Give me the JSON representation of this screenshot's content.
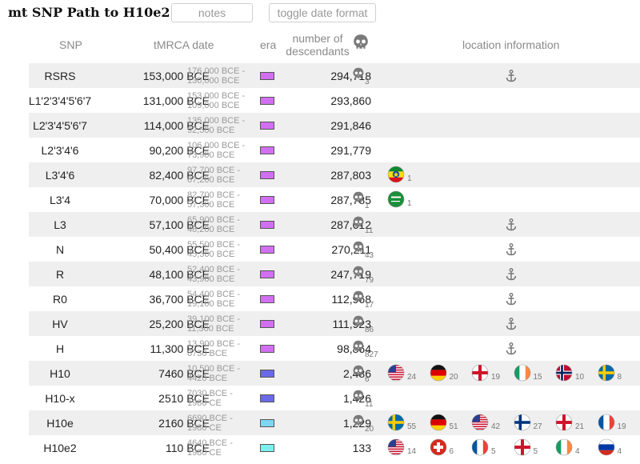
{
  "app": {
    "title": "mt SNP Path to H10e2",
    "notes_button": "notes",
    "date_button": "toggle date format"
  },
  "columns": {
    "snp": "SNP",
    "tmrca": "tMRCA date",
    "era": "era",
    "descendants_1": "number of",
    "descendants_2": "descendants",
    "location": "location information"
  },
  "colors": {
    "era_purple": "#d070f0",
    "era_blue": "#6a6ae8",
    "era_sky": "#7fd6f2",
    "era_aqua": "#7ef0f0",
    "stripe": "#efefef"
  },
  "rows": [
    {
      "snp": "RSRS",
      "date": "153,000 BCE",
      "range1": "176,000 BCE -",
      "range2": "130,000 BCE",
      "era": "era_purple",
      "descendants": "294,718",
      "skull": "3",
      "anchor": true,
      "flags": []
    },
    {
      "snp": "L1'2'3'4'5'6'7",
      "date": "131,000 BCE",
      "range1": "153,000 BCE -",
      "range2": "109,000 BCE",
      "era": "era_purple",
      "descendants": "293,860",
      "skull": null,
      "anchor": false,
      "flags": []
    },
    {
      "snp": "L2'3'4'5'6'7",
      "date": "114,000 BCE",
      "range1": "135,000 BCE -",
      "range2": "92,500 BCE",
      "era": "era_purple",
      "descendants": "291,846",
      "skull": null,
      "anchor": false,
      "flags": []
    },
    {
      "snp": "L2'3'4'6",
      "date": "90,200 BCE",
      "range1": "106,000 BCE -",
      "range2": "73,900 BCE",
      "era": "era_purple",
      "descendants": "291,779",
      "skull": null,
      "anchor": false,
      "flags": []
    },
    {
      "snp": "L3'4'6",
      "date": "82,400 BCE",
      "range1": "97,700 BCE -",
      "range2": "67,200 BCE",
      "era": "era_purple",
      "descendants": "287,803",
      "skull": null,
      "anchor": false,
      "flags": [
        {
          "country": "ethiopia",
          "count": "1"
        }
      ]
    },
    {
      "snp": "L3'4",
      "date": "70,000 BCE",
      "range1": "82,700 BCE -",
      "range2": "57,300 BCE",
      "era": "era_purple",
      "descendants": "287,785",
      "skull": "1",
      "anchor": false,
      "flags": [
        {
          "country": "saudi-arabia",
          "count": "1"
        }
      ]
    },
    {
      "snp": "L3",
      "date": "57,100 BCE",
      "range1": "65,900 BCE -",
      "range2": "48,200 BCE",
      "era": "era_purple",
      "descendants": "287,612",
      "skull": "11",
      "anchor": true,
      "flags": []
    },
    {
      "snp": "N",
      "date": "50,400 BCE",
      "range1": "55,500 BCE -",
      "range2": "45,300 BCE",
      "era": "era_purple",
      "descendants": "270,211",
      "skull": "43",
      "anchor": true,
      "flags": []
    },
    {
      "snp": "R",
      "date": "48,100 BCE",
      "range1": "52,400 BCE -",
      "range2": "43,900 BCE",
      "era": "era_purple",
      "descendants": "247,719",
      "skull": "79",
      "anchor": true,
      "flags": []
    },
    {
      "snp": "R0",
      "date": "36,700 BCE",
      "range1": "54,400 BCE -",
      "range2": "19,100 BCE",
      "era": "era_purple",
      "descendants": "112,968",
      "skull": "17",
      "anchor": true,
      "flags": []
    },
    {
      "snp": "HV",
      "date": "25,200 BCE",
      "range1": "39,100 BCE -",
      "range2": "11,300 BCE",
      "era": "era_purple",
      "descendants": "111,923",
      "skull": "86",
      "anchor": true,
      "flags": []
    },
    {
      "snp": "H",
      "date": "11,300 BCE",
      "range1": "13,900 BCE -",
      "range2": "8730 BCE",
      "era": "era_purple",
      "descendants": "98,864",
      "skull": "827",
      "anchor": true,
      "flags": []
    },
    {
      "snp": "H10",
      "date": "7460 BCE",
      "range1": "10,500 BCE -",
      "range2": "4420 BCE",
      "era": "era_blue",
      "descendants": "2,486",
      "skull": "6",
      "anchor": false,
      "flags": [
        {
          "country": "usa",
          "count": "24"
        },
        {
          "country": "germany",
          "count": "20"
        },
        {
          "country": "england",
          "count": "19"
        },
        {
          "country": "ireland",
          "count": "15"
        },
        {
          "country": "norway",
          "count": "10"
        },
        {
          "country": "sweden",
          "count": "8"
        }
      ]
    },
    {
      "snp": "H10-x",
      "date": "2510 BCE",
      "range1": "7030 BCE -",
      "range2": "1980   CE",
      "era": "era_blue",
      "descendants": "1,426",
      "skull": "11",
      "anchor": false,
      "flags": []
    },
    {
      "snp": "H10e",
      "date": "2160 BCE",
      "range1": "6690 BCE -",
      "range2": "1980   CE",
      "era": "era_sky",
      "descendants": "1,229",
      "skull": "20",
      "anchor": false,
      "flags": [
        {
          "country": "sweden",
          "count": "55"
        },
        {
          "country": "germany",
          "count": "51"
        },
        {
          "country": "usa",
          "count": "42"
        },
        {
          "country": "finland",
          "count": "27"
        },
        {
          "country": "england",
          "count": "21"
        },
        {
          "country": "france",
          "count": "19"
        }
      ]
    },
    {
      "snp": "H10e2",
      "date": "110 BCE",
      "range1": "4640 BCE -",
      "range2": "1980   CE",
      "era": "era_aqua",
      "descendants": "133",
      "skull": null,
      "anchor": false,
      "flags": [
        {
          "country": "usa",
          "count": "14"
        },
        {
          "country": "switzerland",
          "count": "6"
        },
        {
          "country": "france",
          "count": "5"
        },
        {
          "country": "england",
          "count": "5"
        },
        {
          "country": "ireland",
          "count": "4"
        },
        {
          "country": "russia",
          "count": "4"
        }
      ]
    }
  ]
}
